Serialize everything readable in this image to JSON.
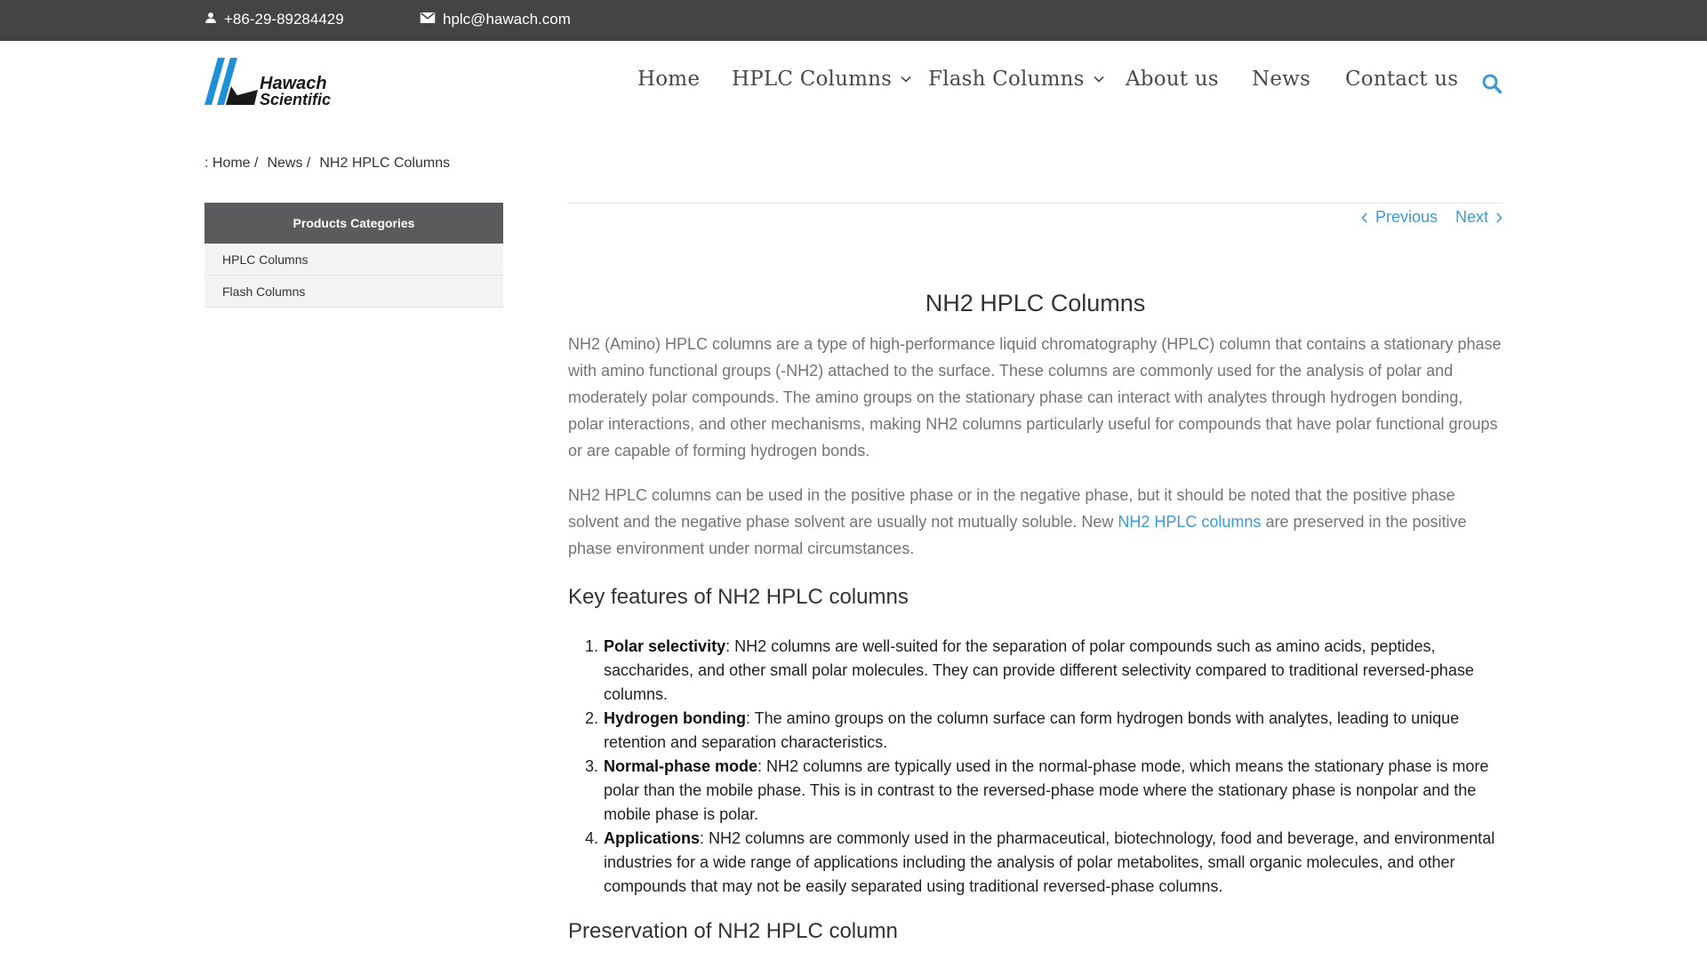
{
  "topbar": {
    "phone": "+86-29-89284429",
    "email": "hplc@hawach.com",
    "phone_icon": "user-icon",
    "email_icon": "mail-icon"
  },
  "logo": {
    "line1": "Hawach",
    "line2": "Scientific"
  },
  "nav": {
    "items": [
      {
        "label": "Home"
      },
      {
        "label": "HPLC Columns"
      },
      {
        "label": "Flash Columns"
      },
      {
        "label": "About us"
      },
      {
        "label": "News"
      },
      {
        "label": "Contact us"
      }
    ]
  },
  "breadcrumb": {
    "prefix": ": Home /",
    "news": "News /",
    "current": "NH2 HPLC Columns"
  },
  "sidebar": {
    "heading": "Products Categories",
    "categories": [
      {
        "label": "HPLC Columns"
      },
      {
        "label": "Flash Columns"
      }
    ]
  },
  "pager": {
    "previous": "Previous",
    "next": "Next"
  },
  "article": {
    "title": "NH2 HPLC Columns",
    "p1": "NH2 (Amino) HPLC columns are a type of high-performance liquid chromatography (HPLC) column that contains a stationary phase with amino functional groups (-NH2) attached to the surface. These columns are commonly used for the analysis of polar and moderately polar compounds. The amino groups on the stationary phase can interact with analytes through hydrogen bonding, polar interactions, and other mechanisms, making NH2 columns particularly useful for compounds that have polar functional groups or are capable of forming hydrogen bonds.",
    "p2_before": "NH2 HPLC columns can be used in the positive phase or in the negative phase, but it should be noted that the positive phase solvent and the negative phase solvent are usually not mutually soluble. New ",
    "p2_link": "NH2 HPLC columns",
    "p2_after": " are preserved in the positive phase environment under normal circumstances.",
    "h_features": "Key features of NH2 HPLC columns",
    "features": [
      {
        "num": "1.",
        "term": "Polar selectivity",
        "text": ": NH2 columns are well-suited for the separation of polar compounds such as amino acids, peptides, saccharides, and other small polar molecules. They can provide different selectivity compared to traditional reversed-phase columns."
      },
      {
        "num": "2.",
        "term": "Hydrogen bonding",
        "text": ": The amino groups on the column surface can form hydrogen bonds with analytes, leading to unique retention and separation characteristics."
      },
      {
        "num": "3.",
        "term": "Normal-phase mode",
        "text": ": NH2 columns are typically used in the normal-phase mode, which means the stationary phase is more polar than the mobile phase. This is in contrast to the reversed-phase mode where the stationary phase is nonpolar and the mobile phase is polar."
      },
      {
        "num": "4.",
        "term": "Applications",
        "text": ": NH2 columns are commonly used in the pharmaceutical, biotechnology, food and beverage, and environmental industries for a wide range of applications including the analysis of polar metabolites, small organic molecules, and other compounds that may not be easily separated using traditional reversed-phase columns."
      }
    ],
    "h_preservation": "Preservation of NH2 HPLC column"
  },
  "colors": {
    "topbar_bg": "#444446",
    "accent": "#3e9bd1",
    "sidebar_head_bg": "#5b5b5d",
    "logo_blue": "#1f8fd6"
  }
}
